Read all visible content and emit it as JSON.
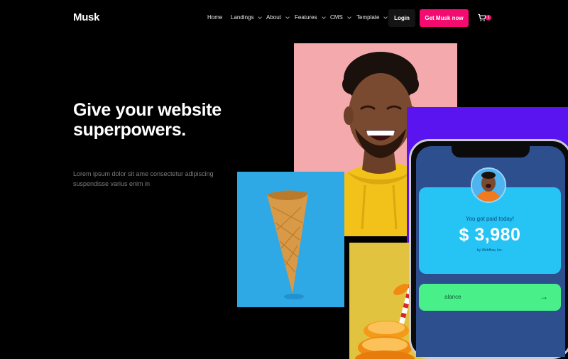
{
  "brand": {
    "logo": "Musk"
  },
  "nav": {
    "items": [
      {
        "label": "Home",
        "dropdown": false
      },
      {
        "label": "Landings",
        "dropdown": true
      },
      {
        "label": "About",
        "dropdown": true
      },
      {
        "label": "Features",
        "dropdown": true
      },
      {
        "label": "CMS",
        "dropdown": true
      },
      {
        "label": "Template",
        "dropdown": true
      }
    ],
    "login_label": "Login",
    "cta_label": "Get Musk now",
    "cart_icon": "cart-icon",
    "cart_count": "1"
  },
  "hero": {
    "title": "Give your website superpowers.",
    "subtitle": "Lorem ipsum dolor sit ame consectetur adipiscing suspendisse varius enim in"
  },
  "phone": {
    "paid_text": "You got paid today!",
    "amount": "$ 3,980",
    "by_text": "by Webflow, Inc.",
    "balance_label": "alance",
    "arrow_icon": "arrow-right-icon"
  },
  "colors": {
    "accent": "#f40b6f",
    "background": "#000000",
    "pink": "#f4a9ad",
    "purple": "#5a14f0",
    "blue": "#2fa8e6",
    "yellow": "#e2c33f",
    "card_blue": "#26c3f5",
    "card_green": "#49f08a"
  }
}
